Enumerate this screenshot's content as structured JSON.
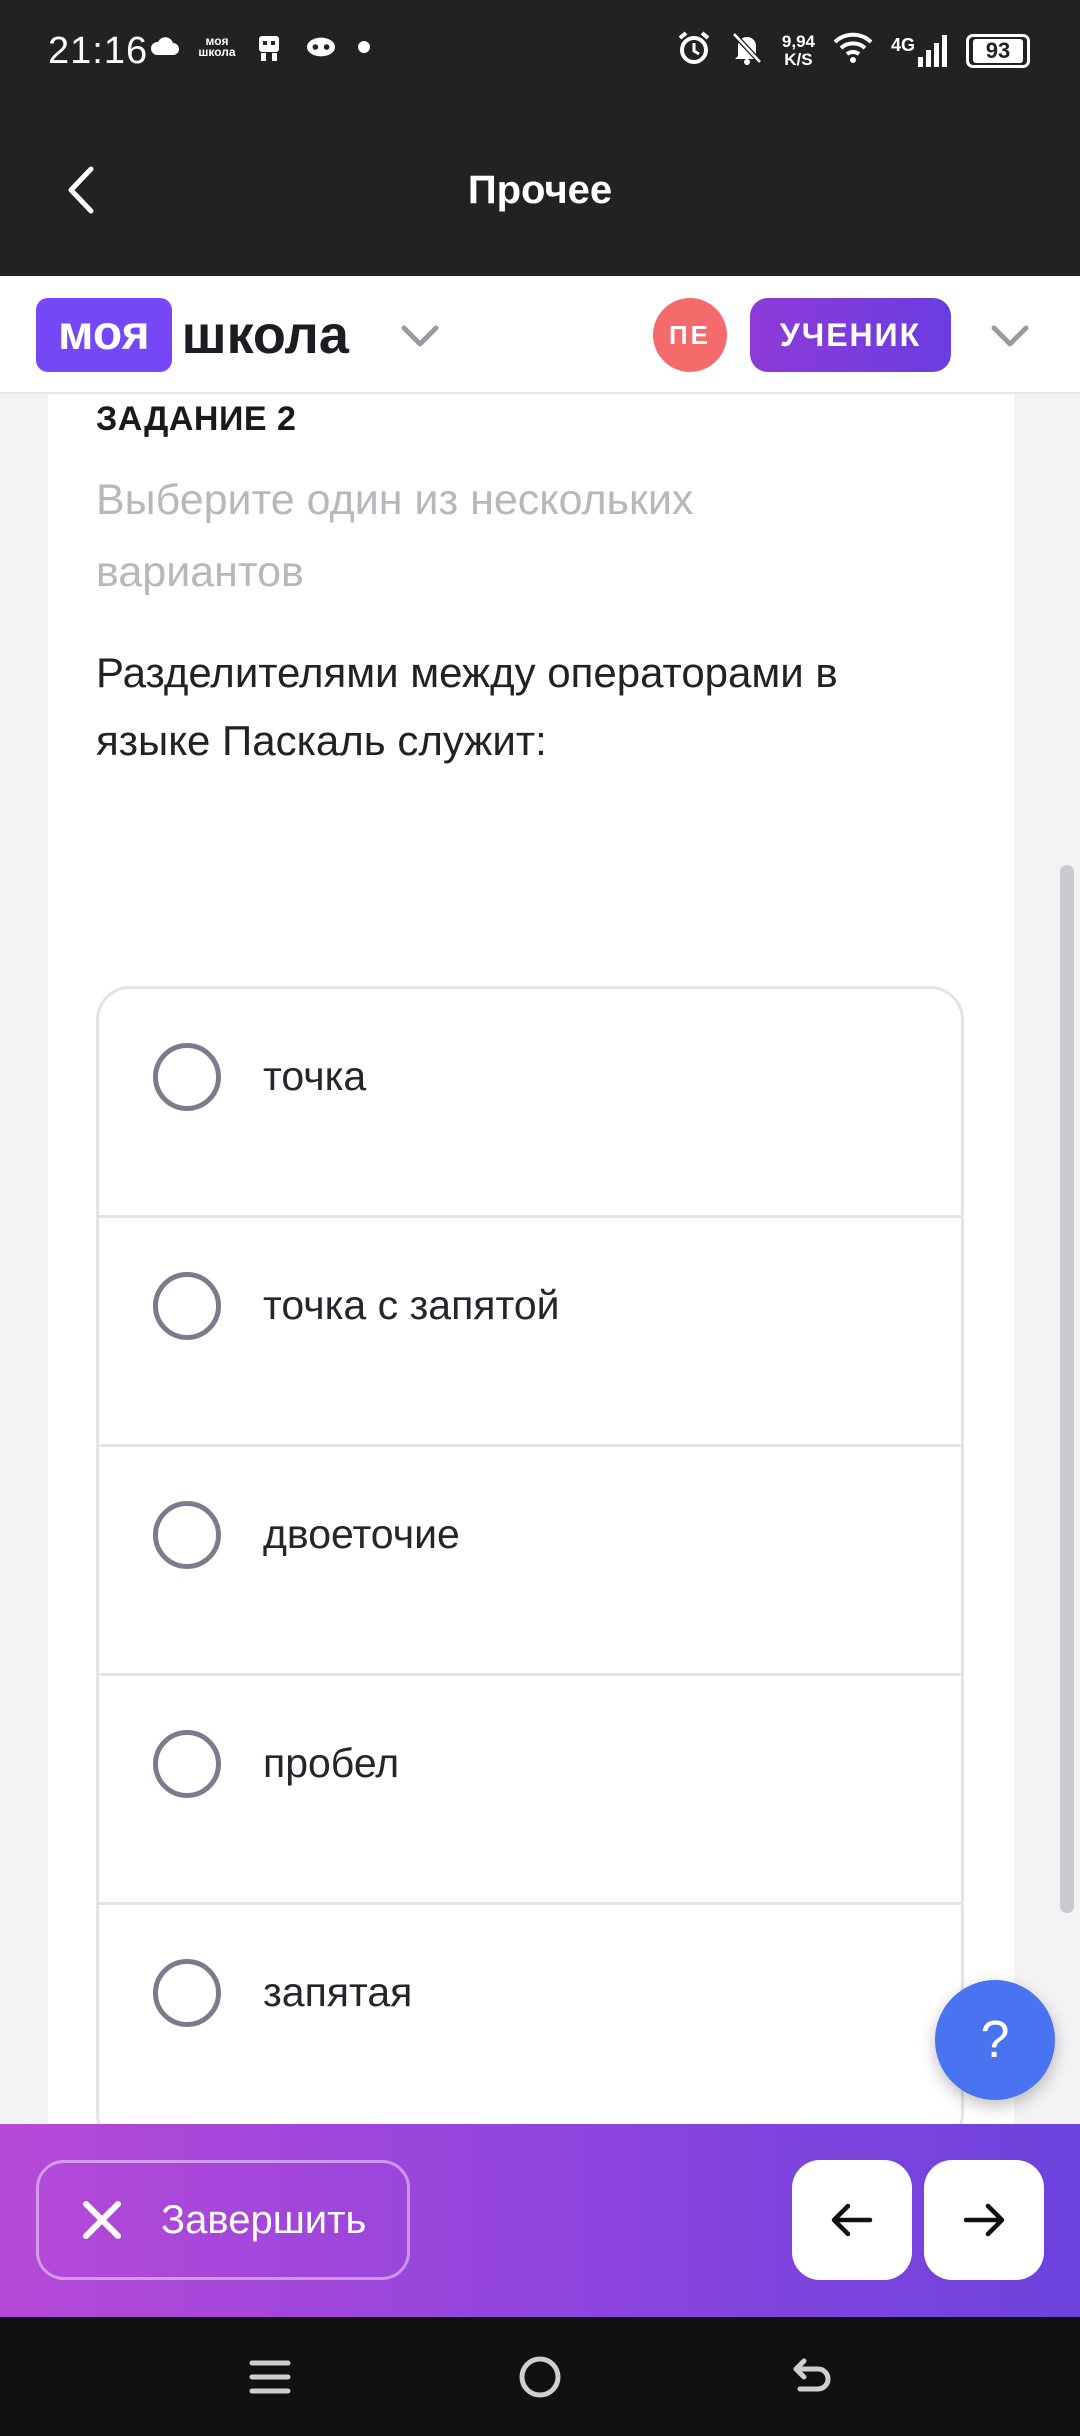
{
  "status_bar": {
    "time": "21:16",
    "left_icons": [
      "cloud-icon",
      "moya-shkola-app-icon",
      "robot-icon",
      "gamepad-icon",
      "dot-icon"
    ],
    "mini_app_label": "моя\nшкола",
    "network_speed_top": "9,94",
    "network_speed_bottom": "K/S",
    "network_type": "4G",
    "battery": "93"
  },
  "title_bar": {
    "title": "Прочее"
  },
  "app_header": {
    "logo_box": "моя",
    "logo_text": "школа",
    "avatar_initials": "ПЕ",
    "role": "УЧЕНИК"
  },
  "task": {
    "label": "ЗАДАНИЕ 2",
    "instruction": "Выберите один из нескольких вариантов",
    "question": "Разделителями между операторами в языке Паскаль служит:",
    "options": [
      {
        "label": "точка",
        "selected": false
      },
      {
        "label": "точка с запятой",
        "selected": false
      },
      {
        "label": "двоеточие",
        "selected": false
      },
      {
        "label": "пробел",
        "selected": false
      },
      {
        "label": "запятая",
        "selected": false
      }
    ]
  },
  "help": {
    "label": "?"
  },
  "bottom_bar": {
    "finish_label": "Завершить",
    "prev_icon": "arrow-left-icon",
    "next_icon": "arrow-right-icon"
  },
  "colors": {
    "accent": "#7547f6",
    "avatar": "#f56a6a",
    "help": "#4a73f2",
    "bottom_gradient_start": "#b649d8",
    "bottom_gradient_end": "#6c43dd"
  }
}
